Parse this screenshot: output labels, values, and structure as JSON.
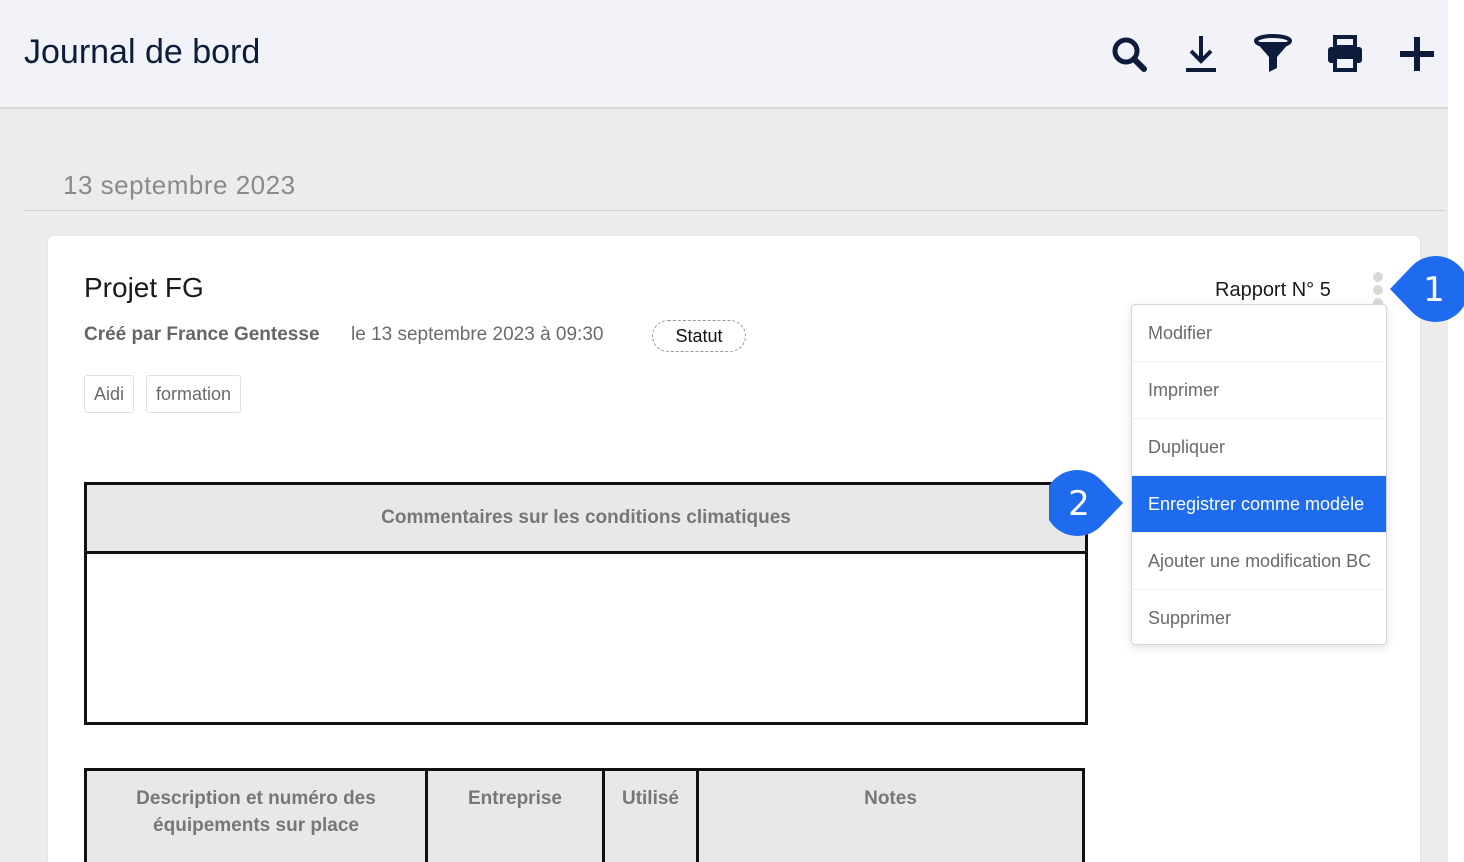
{
  "header": {
    "title": "Journal de bord",
    "actions": [
      {
        "name": "search-icon",
        "label": "search"
      },
      {
        "name": "download-icon",
        "label": "download"
      },
      {
        "name": "filter-icon",
        "label": "filter"
      },
      {
        "name": "print-icon",
        "label": "print"
      },
      {
        "name": "add-icon",
        "label": "add"
      }
    ]
  },
  "date_heading": "13 septembre 2023",
  "report": {
    "project": "Projet FG",
    "created_by": "Créé par France Gentesse",
    "created_date": "le 13 septembre 2023 à 09:30",
    "status_label": "Statut",
    "number": "Rapport N° 5",
    "tags": [
      "Aidi",
      "formation"
    ]
  },
  "climate_table": {
    "header": "Commentaires sur les conditions climatiques"
  },
  "equipment_table": {
    "columns": [
      "Description et numéro des équipements sur place",
      "Entreprise",
      "Utilisé",
      "Notes"
    ]
  },
  "context_menu": {
    "items": [
      "Modifier",
      "Imprimer",
      "Dupliquer",
      "Enregistrer comme modèle",
      "Ajouter une modification BC",
      "Supprimer"
    ],
    "active_index": 3
  },
  "callouts": [
    "1",
    "2"
  ],
  "colors": {
    "accent": "#1f6bf0",
    "header_bg": "#f2f3f8",
    "page_bg": "#ececec",
    "title_text": "#0c1c3a"
  }
}
